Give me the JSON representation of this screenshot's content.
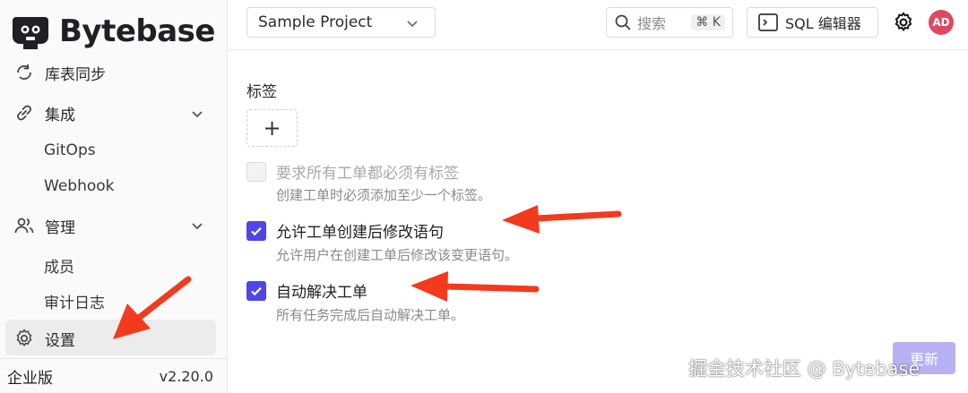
{
  "brand": {
    "name": "Bytebase"
  },
  "sidebar": {
    "items": [
      {
        "label": "库表同步",
        "icon": "sync-icon"
      },
      {
        "label": "集成",
        "icon": "link-icon",
        "expanded": true
      },
      {
        "label": "GitOps"
      },
      {
        "label": "Webhook"
      },
      {
        "label": "管理",
        "icon": "users-icon",
        "expanded": true
      },
      {
        "label": "成员"
      },
      {
        "label": "审计日志"
      },
      {
        "label": "设置",
        "icon": "gear-icon",
        "active": true
      }
    ],
    "edition": "企业版",
    "version": "v2.20.0"
  },
  "topbar": {
    "project": "Sample Project",
    "search_placeholder": "搜索",
    "search_shortcut": "⌘ K",
    "sql_editor_label": "SQL 编辑器",
    "avatar_initials": "AD"
  },
  "main": {
    "tags_label": "标签",
    "add_symbol": "+",
    "options": [
      {
        "label": "要求所有工单都必须有标签",
        "desc": "创建工单时必须添加至少一个标签。",
        "checked": false,
        "disabled": true
      },
      {
        "label": "允许工单创建后修改语句",
        "desc": "允许用户在创建工单后修改该变更语句。",
        "checked": true,
        "disabled": false
      },
      {
        "label": "自动解决工单",
        "desc": "所有任务完成后自动解决工单。",
        "checked": true,
        "disabled": false
      }
    ],
    "update_label": "更新"
  },
  "watermark": "掘金技术社区 @ Bytebase",
  "colors": {
    "accent": "#4f46e5",
    "avatar": "#e04862",
    "arrow": "#f23a1e"
  }
}
